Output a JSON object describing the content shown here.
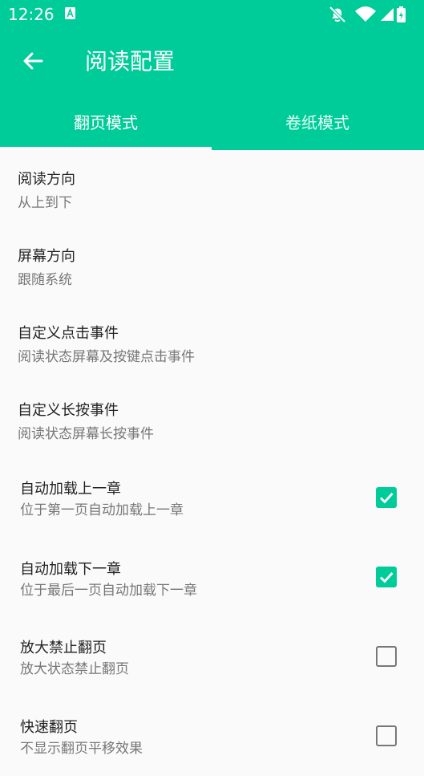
{
  "status": {
    "time": "12:26"
  },
  "appbar": {
    "title": "阅读配置"
  },
  "tabs": [
    {
      "label": "翻页模式"
    },
    {
      "label": "卷纸模式"
    }
  ],
  "settings": [
    {
      "title": "阅读方向",
      "summary": "从上到下"
    },
    {
      "title": "屏幕方向",
      "summary": "跟随系统"
    },
    {
      "title": "自定义点击事件",
      "summary": "阅读状态屏幕及按键点击事件"
    },
    {
      "title": "自定义长按事件",
      "summary": "阅读状态屏幕长按事件"
    },
    {
      "title": "自动加载上一章",
      "summary": "位于第一页自动加载上一章",
      "checked": true
    },
    {
      "title": "自动加载下一章",
      "summary": "位于最后一页自动加载下一章",
      "checked": true
    },
    {
      "title": "放大禁止翻页",
      "summary": "放大状态禁止翻页",
      "checked": false
    },
    {
      "title": "快速翻页",
      "summary": "不显示翻页平移效果",
      "checked": false
    }
  ],
  "colors": {
    "accent": "#00cc99"
  },
  "icons": {
    "back": "arrow-left-icon",
    "check": "check-icon"
  }
}
